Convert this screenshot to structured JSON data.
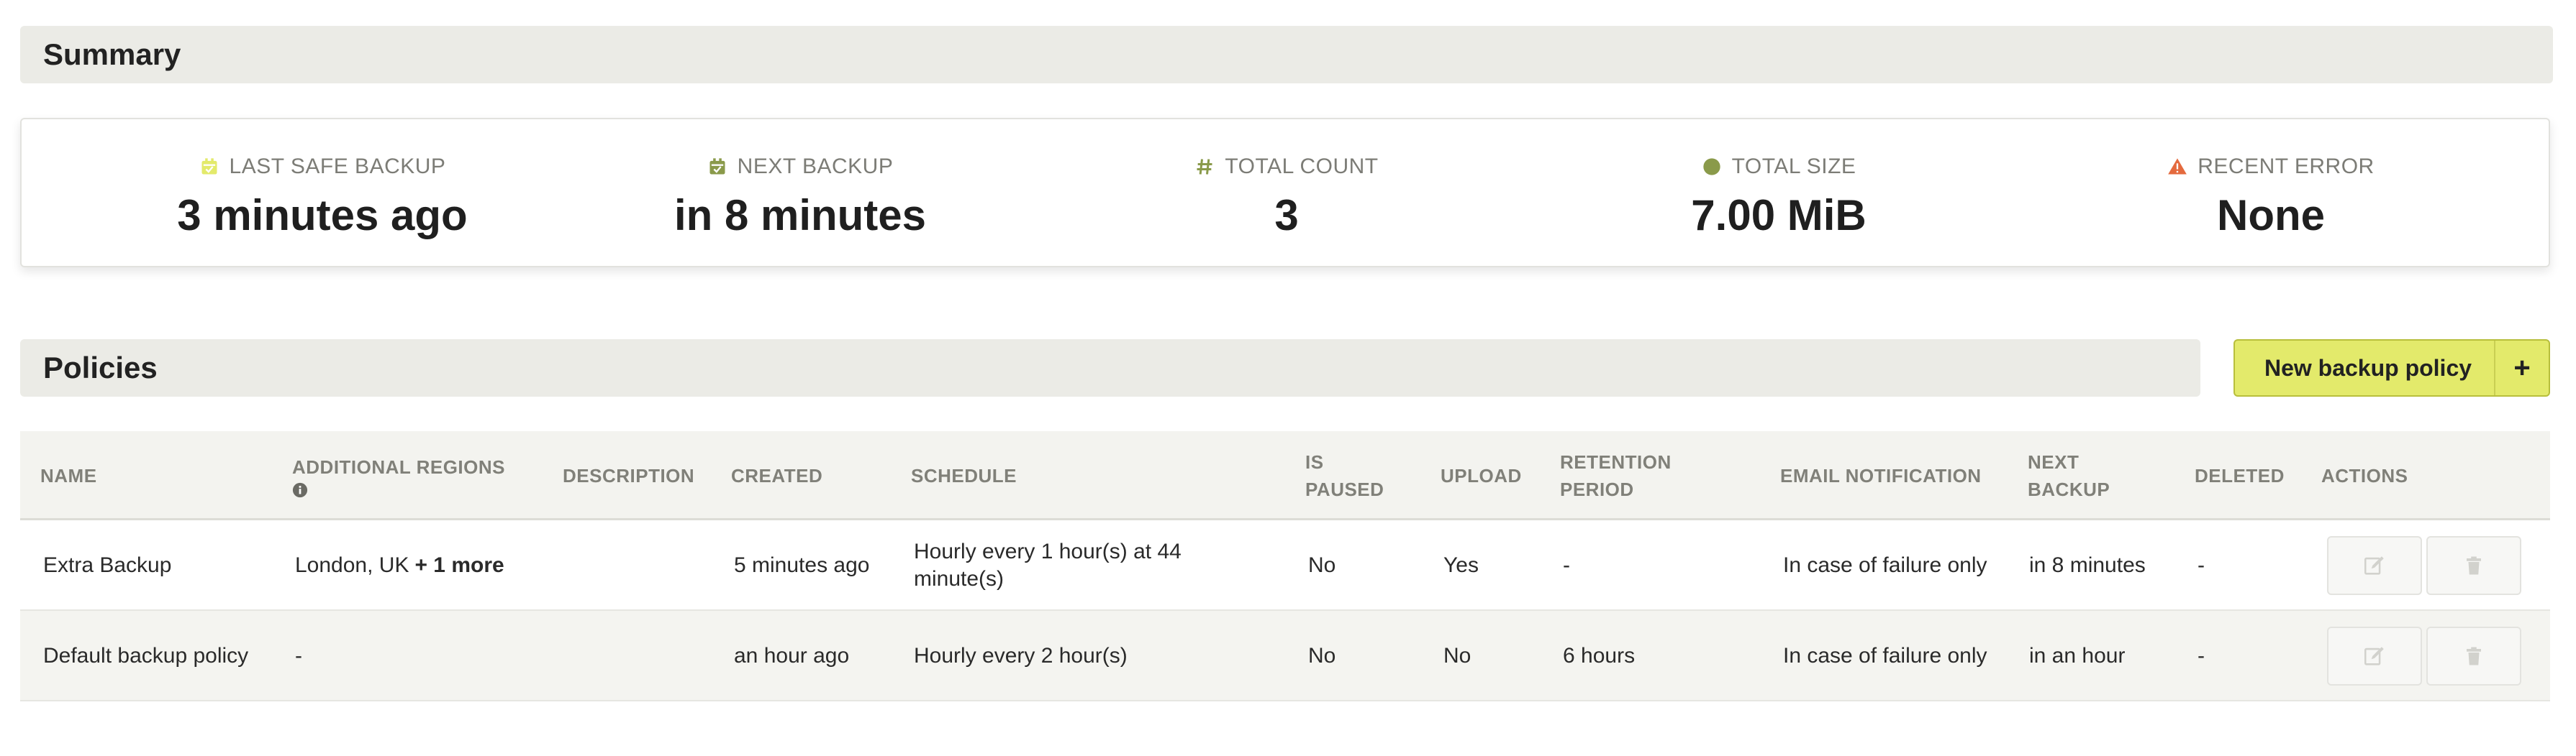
{
  "summary": {
    "title": "Summary",
    "stats": [
      {
        "label": "LAST SAFE BACKUP",
        "value": "3 minutes ago",
        "icon": "calendar-icon",
        "color": "#e3ea6b"
      },
      {
        "label": "NEXT BACKUP",
        "value": "in 8 minutes",
        "icon": "calendar-check-icon",
        "color": "#8a9a4a"
      },
      {
        "label": "TOTAL COUNT",
        "value": "3",
        "icon": "hash-icon",
        "color": "#8a9a4a"
      },
      {
        "label": "TOTAL SIZE",
        "value": "7.00 MiB",
        "icon": "circle-icon",
        "color": "#8a9a4a"
      },
      {
        "label": "RECENT ERROR",
        "value": "None",
        "icon": "warning-icon",
        "color": "#e46a3e"
      }
    ]
  },
  "policies": {
    "title": "Policies",
    "new_button_label": "New backup policy",
    "new_button_plus": "+",
    "columns": {
      "name": "NAME",
      "additional_regions": "ADDITIONAL REGIONS",
      "description": "DESCRIPTION",
      "created": "CREATED",
      "schedule": "SCHEDULE",
      "is_paused_1": "IS",
      "is_paused_2": "PAUSED",
      "upload": "UPLOAD",
      "retention_1": "RETENTION",
      "retention_2": "PERIOD",
      "email": "EMAIL NOTIFICATION",
      "next_1": "NEXT",
      "next_2": "BACKUP",
      "deleted": "DELETED",
      "actions": "ACTIONS"
    },
    "rows": [
      {
        "name": "Extra Backup",
        "regions": "London, UK",
        "regions_more": "+ 1 more",
        "description": "",
        "created": "5 minutes ago",
        "schedule": "Hourly every 1 hour(s) at 44 minute(s)",
        "is_paused": "No",
        "upload": "Yes",
        "retention": "-",
        "email": "In case of failure only",
        "next_backup": "in 8 minutes",
        "deleted": "-"
      },
      {
        "name": "Default backup policy",
        "regions": "-",
        "regions_more": "",
        "description": "",
        "created": "an hour ago",
        "schedule": "Hourly every 2 hour(s)",
        "is_paused": "No",
        "upload": "No",
        "retention": "6 hours",
        "email": "In case of failure only",
        "next_backup": "in an hour",
        "deleted": "-"
      }
    ]
  }
}
